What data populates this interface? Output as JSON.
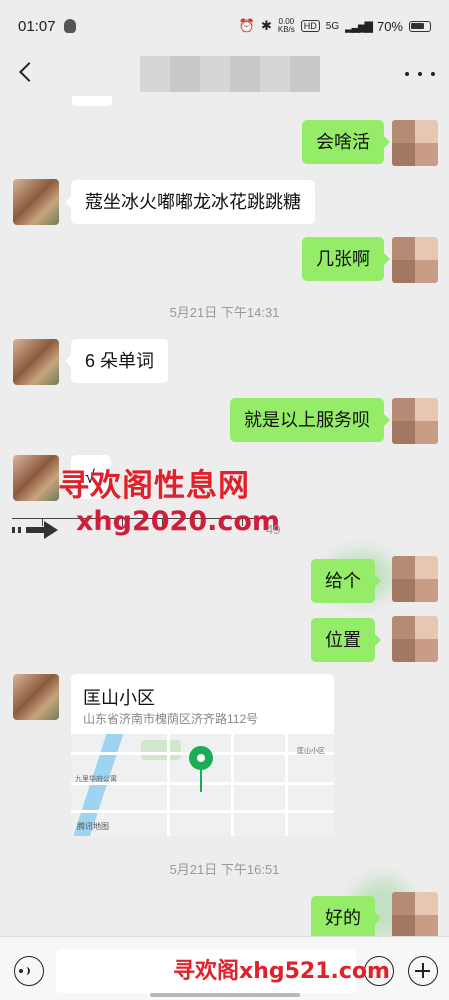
{
  "status_bar": {
    "time": "01:07",
    "net_speed": "0.00",
    "net_unit": "KB/s",
    "hd": "HD",
    "network": "5G",
    "battery": "70%"
  },
  "messages": [
    {
      "from": "me",
      "text": "会啥活"
    },
    {
      "from": "other",
      "text": "蔻坐冰火嘟嘟龙冰花跳跳糖"
    },
    {
      "from": "me",
      "text": "几张啊"
    },
    {
      "from": "other",
      "text": "6 朵单词"
    },
    {
      "from": "me",
      "text": "就是以上服务呗"
    },
    {
      "from": "other",
      "text": "√"
    },
    {
      "from": "me",
      "text": "给个"
    },
    {
      "from": "me",
      "text": "位置"
    },
    {
      "from": "me",
      "text": "好的"
    }
  ],
  "timestamps": [
    "5月21日 下午14:31",
    "5月21日 下午16:51"
  ],
  "timestamp_fragment": "49",
  "location": {
    "name": "匡山小区",
    "address": "山东省济南市槐荫区济齐路112号",
    "map_provider": "腾讯地图",
    "poi_1": "九里华府公寓",
    "poi_2": "匡山小区"
  },
  "watermarks": {
    "line1": "寻欢阁性息网",
    "line2": "xhg2020.com",
    "bottom": "寻欢阁xhg521.com"
  },
  "colors": {
    "background": "#ededed",
    "my_bubble": "#95ec69",
    "their_bubble": "#ffffff",
    "map_pin": "#1aad54",
    "watermark": "#e0202a"
  },
  "icons": {
    "back": "back-chevron-icon",
    "more": "more-dots-icon",
    "voice": "voice-icon",
    "emoji": "emoji-icon",
    "plus": "plus-icon",
    "pin": "location-pin-icon"
  }
}
